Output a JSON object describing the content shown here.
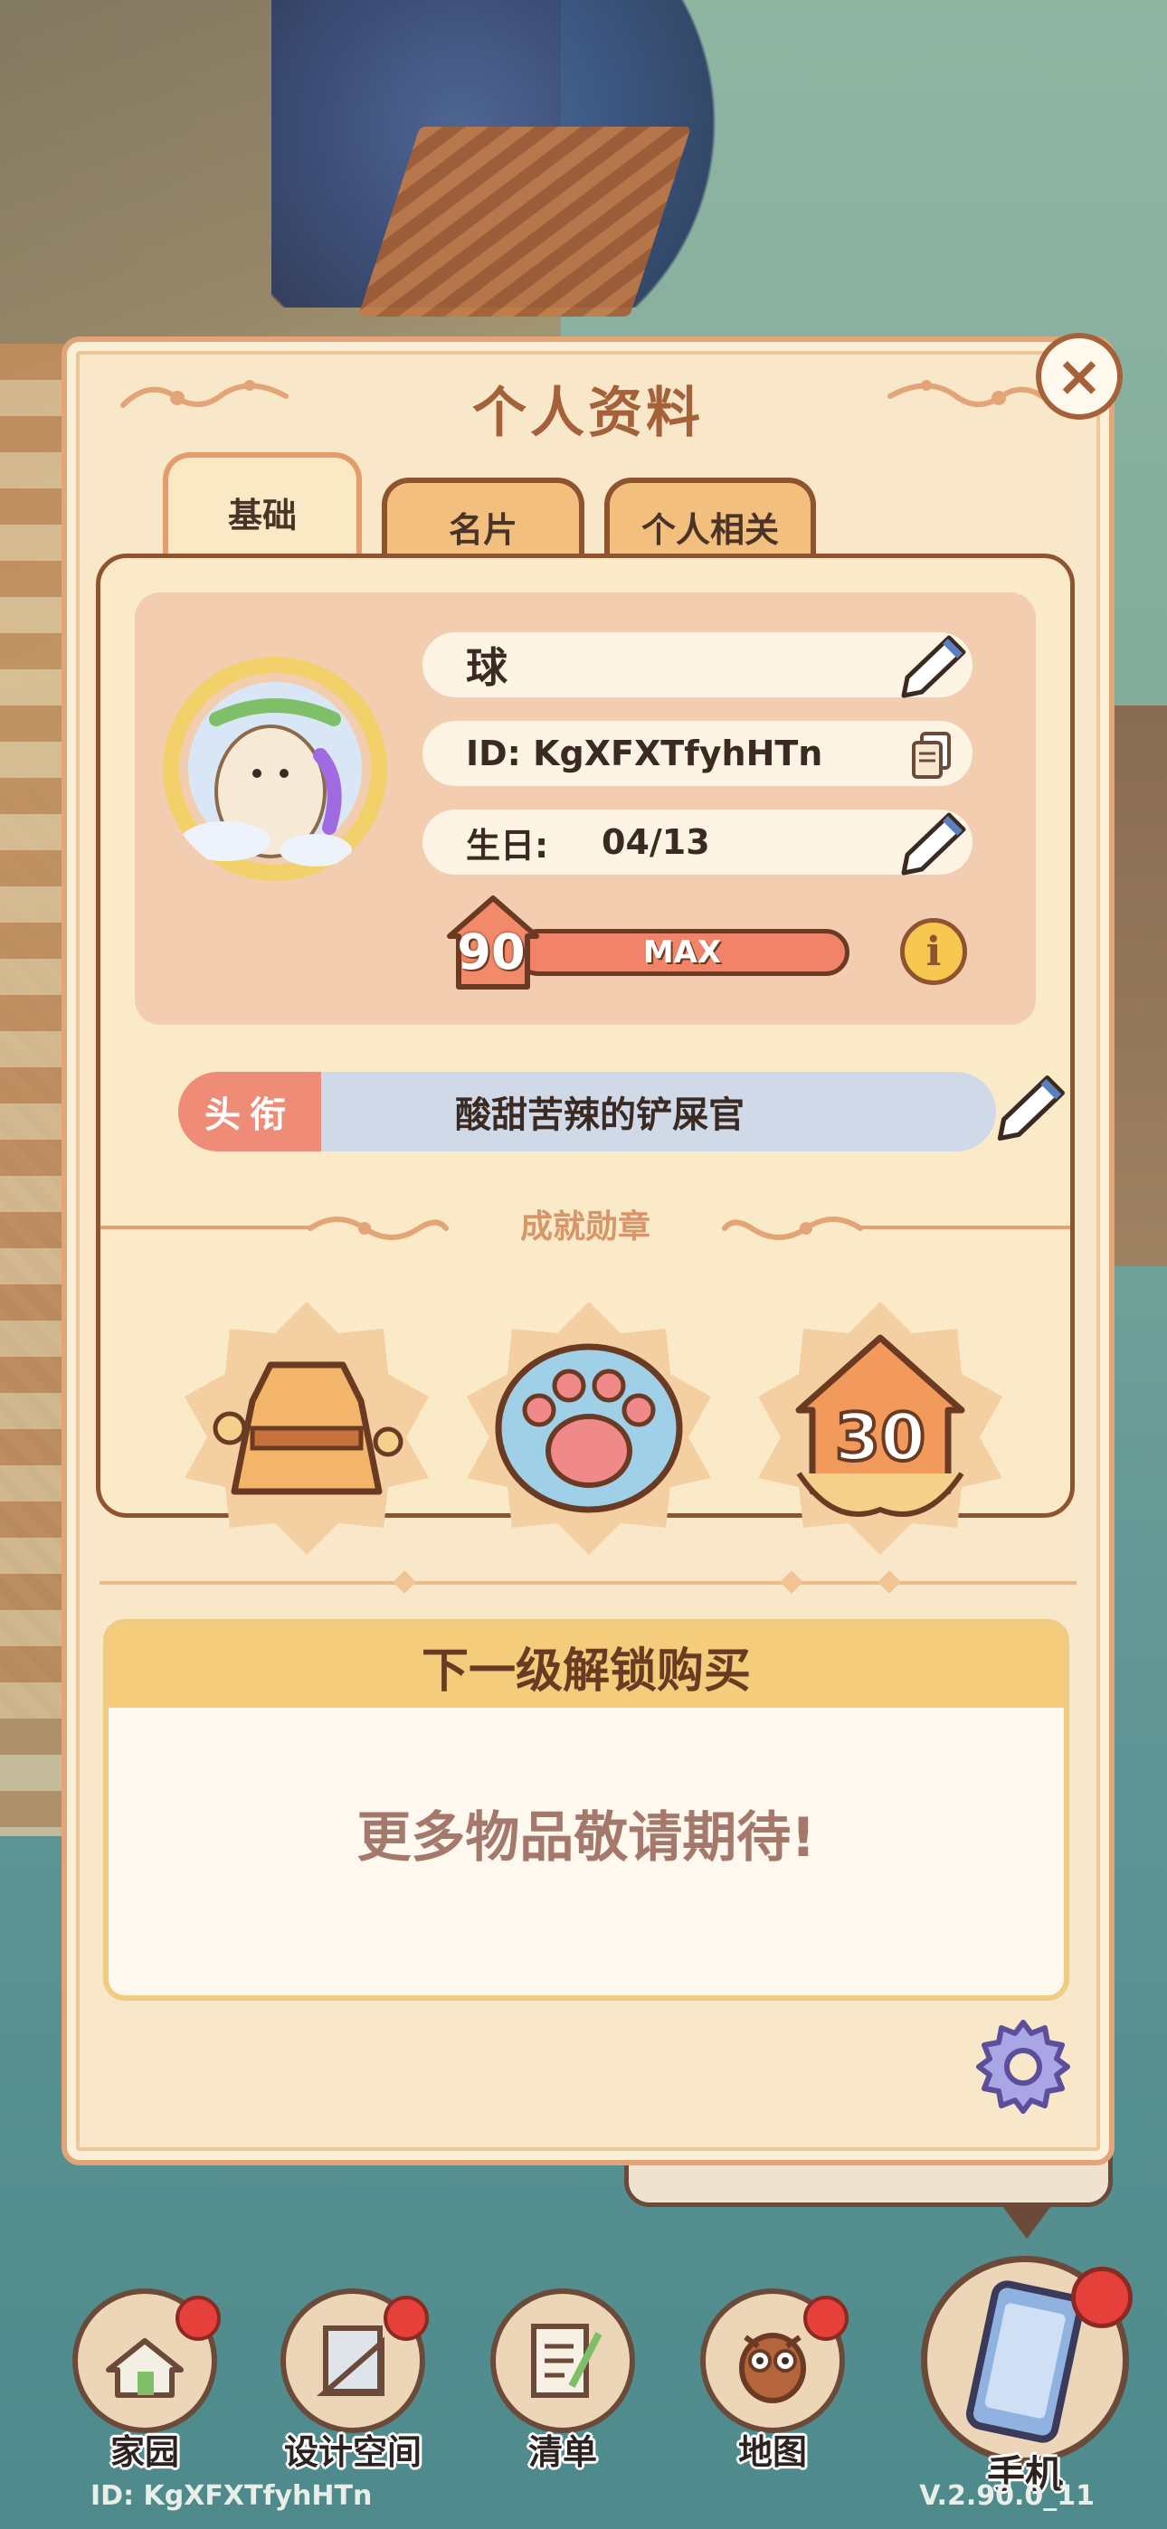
{
  "dialog": {
    "title": "个人资料",
    "tabs": [
      {
        "label": "基础",
        "active": true
      },
      {
        "label": "名片",
        "active": false
      },
      {
        "label": "个人相关",
        "active": false
      }
    ]
  },
  "profile": {
    "name": "球",
    "id_text": "ID: KgXFXTfyhHTn",
    "birthday_label": "生日:",
    "birthday_value": "04/13",
    "level": "90",
    "level_bar_text": "MAX",
    "level_progress": 1.0
  },
  "honor_title": {
    "tag": "头衔",
    "value": "酸甜苦辣的铲屎官"
  },
  "achievements": {
    "label": "成就勋章",
    "medals": [
      {
        "icon": "dress-medal-icon"
      },
      {
        "icon": "paw-medal-icon"
      },
      {
        "icon": "level-30-medal-icon",
        "text": "30"
      }
    ]
  },
  "unlock": {
    "header": "下一级解锁购买",
    "message": "更多物品敬请期待!"
  },
  "nav": [
    {
      "label": "家园",
      "icon": "home-icon"
    },
    {
      "label": "设计空间",
      "icon": "design-icon"
    },
    {
      "label": "清单",
      "icon": "list-icon"
    },
    {
      "label": "地图",
      "icon": "map-owl-icon"
    }
  ],
  "phone": {
    "label": "手机",
    "icon": "phone-icon"
  },
  "footer": {
    "id": "ID:  KgXFXTfyhHTn",
    "version": "V.2.90.0_11"
  },
  "colors": {
    "dialog_bg": "#f8e7c9",
    "accent_brown": "#a5623a",
    "tag_red": "#ef8c77",
    "title_bg": "#cfd9e8",
    "badge_red": "#e6403b"
  }
}
